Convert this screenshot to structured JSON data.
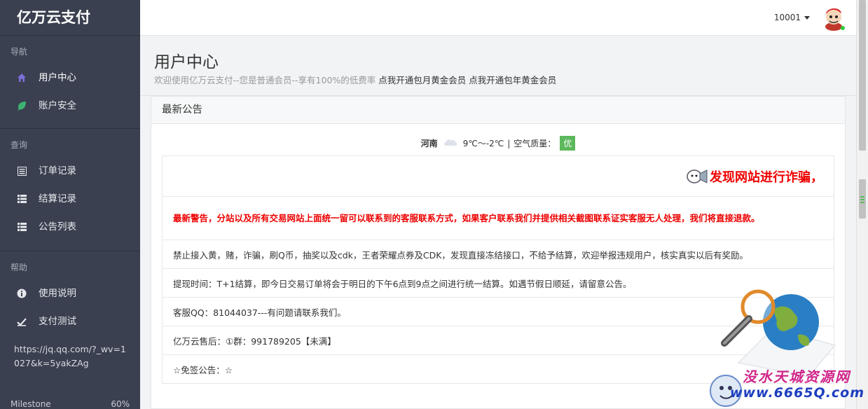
{
  "sidebar": {
    "brand": "亿万云支付",
    "sections": [
      {
        "header": "导航",
        "items": [
          {
            "label": "用户中心",
            "icon": "home-icon"
          },
          {
            "label": "账户安全",
            "icon": "leaf-icon"
          }
        ]
      },
      {
        "header": "查询",
        "items": [
          {
            "label": "订单记录",
            "icon": "list-alt-icon"
          },
          {
            "label": "结算记录",
            "icon": "th-list-icon"
          },
          {
            "label": "公告列表",
            "icon": "th-list-icon"
          }
        ]
      },
      {
        "header": "帮助",
        "items": [
          {
            "label": "使用说明",
            "icon": "info-circle-icon"
          },
          {
            "label": "支付测试",
            "icon": "check-square-icon"
          }
        ]
      }
    ],
    "url_text": "https://jq.qq.com/?_wv=1027&k=5yakZAg",
    "milestone": {
      "label": "Milestone",
      "value": "60%"
    }
  },
  "topbar": {
    "username": "10001"
  },
  "page_header": {
    "title": "用户中心",
    "subtitle": "欢迎使用亿万云支付--您是普通会员--享有100%的低费率",
    "link_monthly": "点我开通包月黄金会员",
    "link_yearly": "点我开通包年黄金会员"
  },
  "panel": {
    "heading": "最新公告",
    "weather": {
      "city": "河南",
      "temp": "9℃～-2℃",
      "sep": "|",
      "aq_label": "空气质量：",
      "aq_value": "优",
      "aq_color": "#5cb85c"
    },
    "banner": "发现网站进行诈骗，",
    "announcements": [
      "最新警告，分站以及所有交易网站上面统一留可以联系到的客服联系方式，如果客户联系我们并提供相关截图联系证实客服无人处理，我们将直接退款。",
      "禁止接入黄，赌，诈骗，刷Q币，抽奖以及cdk，王者荣耀点券及CDK，发现直接冻结接口，不给予结算，欢迎举报违规用户，核实真实以后有奖励。",
      "提现时间：T+1结算，即今日交易订单将会于明日的下午6点到9点之间进行统一结算。如遇节假日顺延，请留意公告。",
      "客服QQ：81044037---有问题请联系我们。",
      "亿万云售后：①群：991789205【未满】",
      "☆免签公告：☆"
    ]
  },
  "watermark": {
    "line1": "没水天城资源网",
    "line2": "www.6665Q.com"
  },
  "colors": {
    "sidebar_bg": "#3a4050",
    "warning_red": "#e00",
    "home_icon": "#6a5acd",
    "leaf_icon": "#3cb371"
  }
}
